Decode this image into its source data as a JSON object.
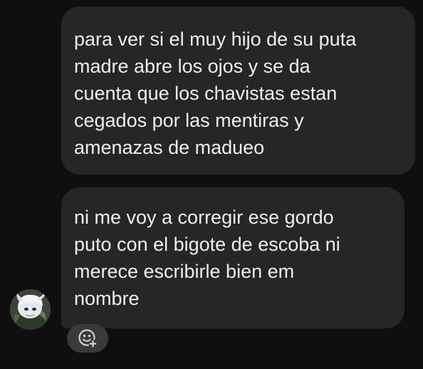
{
  "messages": [
    {
      "lines": [
        "para ver si el muy hijo de su puta",
        "madre abre los ojos y se da",
        "cuenta que los chavistas estan",
        "cegados por las mentiras y",
        "amenazas de madueo"
      ]
    },
    {
      "lines": [
        "ni me voy a corregir ese gordo",
        "puto con el bigote de escoba ni",
        "merece escribirle bien em",
        "nombre"
      ]
    }
  ],
  "icons": {
    "avatar": "sender-avatar",
    "reaction": "add-reaction-icon"
  },
  "colors": {
    "background": "#0f0f10",
    "bubble": "#262628",
    "text": "#eeeeee",
    "reaction_button": "#3a3a3c"
  }
}
